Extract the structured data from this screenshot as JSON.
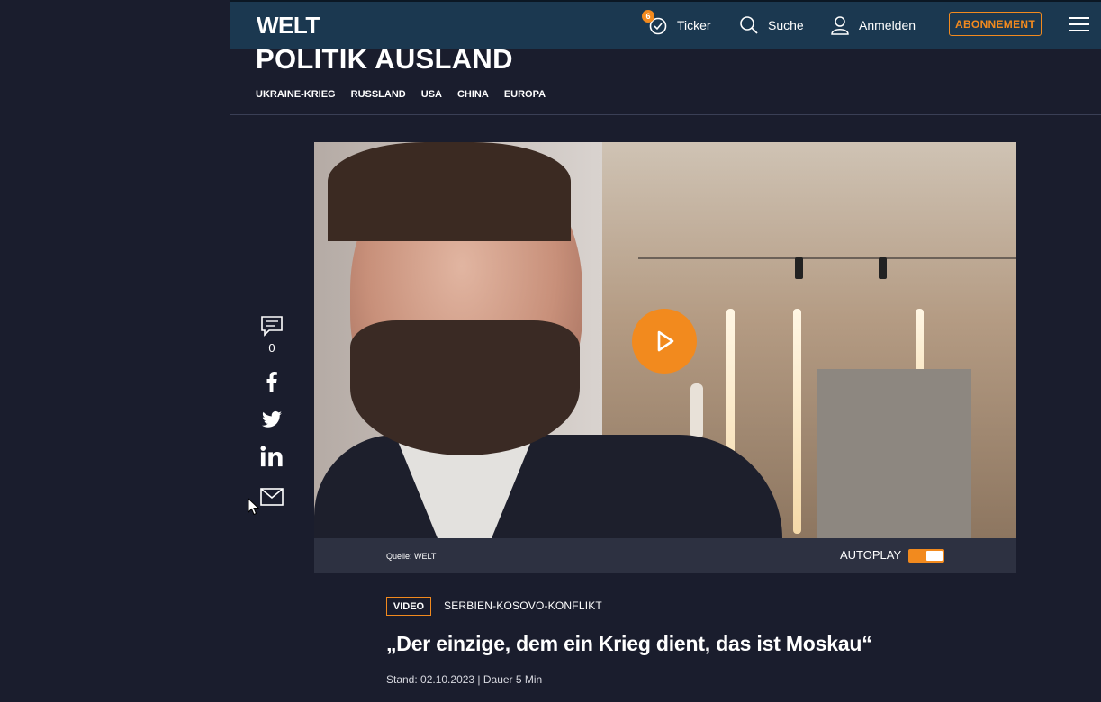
{
  "header": {
    "logo": "WELT",
    "ticker_label": "Ticker",
    "ticker_badge": "6",
    "search_label": "Suche",
    "login_label": "Anmelden",
    "subscribe_label": "ABONNEMENT",
    "accent_color": "#f28a1e"
  },
  "section": {
    "title": "POLITIK AUSLAND",
    "subnav": [
      "UKRAINE-KRIEG",
      "RUSSLAND",
      "USA",
      "CHINA",
      "EUROPA"
    ]
  },
  "share": {
    "comment_count": "0",
    "icons": [
      "comment-icon",
      "facebook-icon",
      "twitter-icon",
      "linkedin-icon",
      "mail-icon"
    ]
  },
  "video": {
    "source": "Quelle: WELT",
    "autoplay_label": "AUTOPLAY",
    "autoplay_on": true
  },
  "article": {
    "badge": "VIDEO",
    "topic": "SERBIEN-KOSOVO-KONFLIKT",
    "headline": "„Der einzige, dem ein Krieg dient, das ist Moskau“",
    "meta": "Stand: 02.10.2023 | Dauer 5 Min"
  }
}
